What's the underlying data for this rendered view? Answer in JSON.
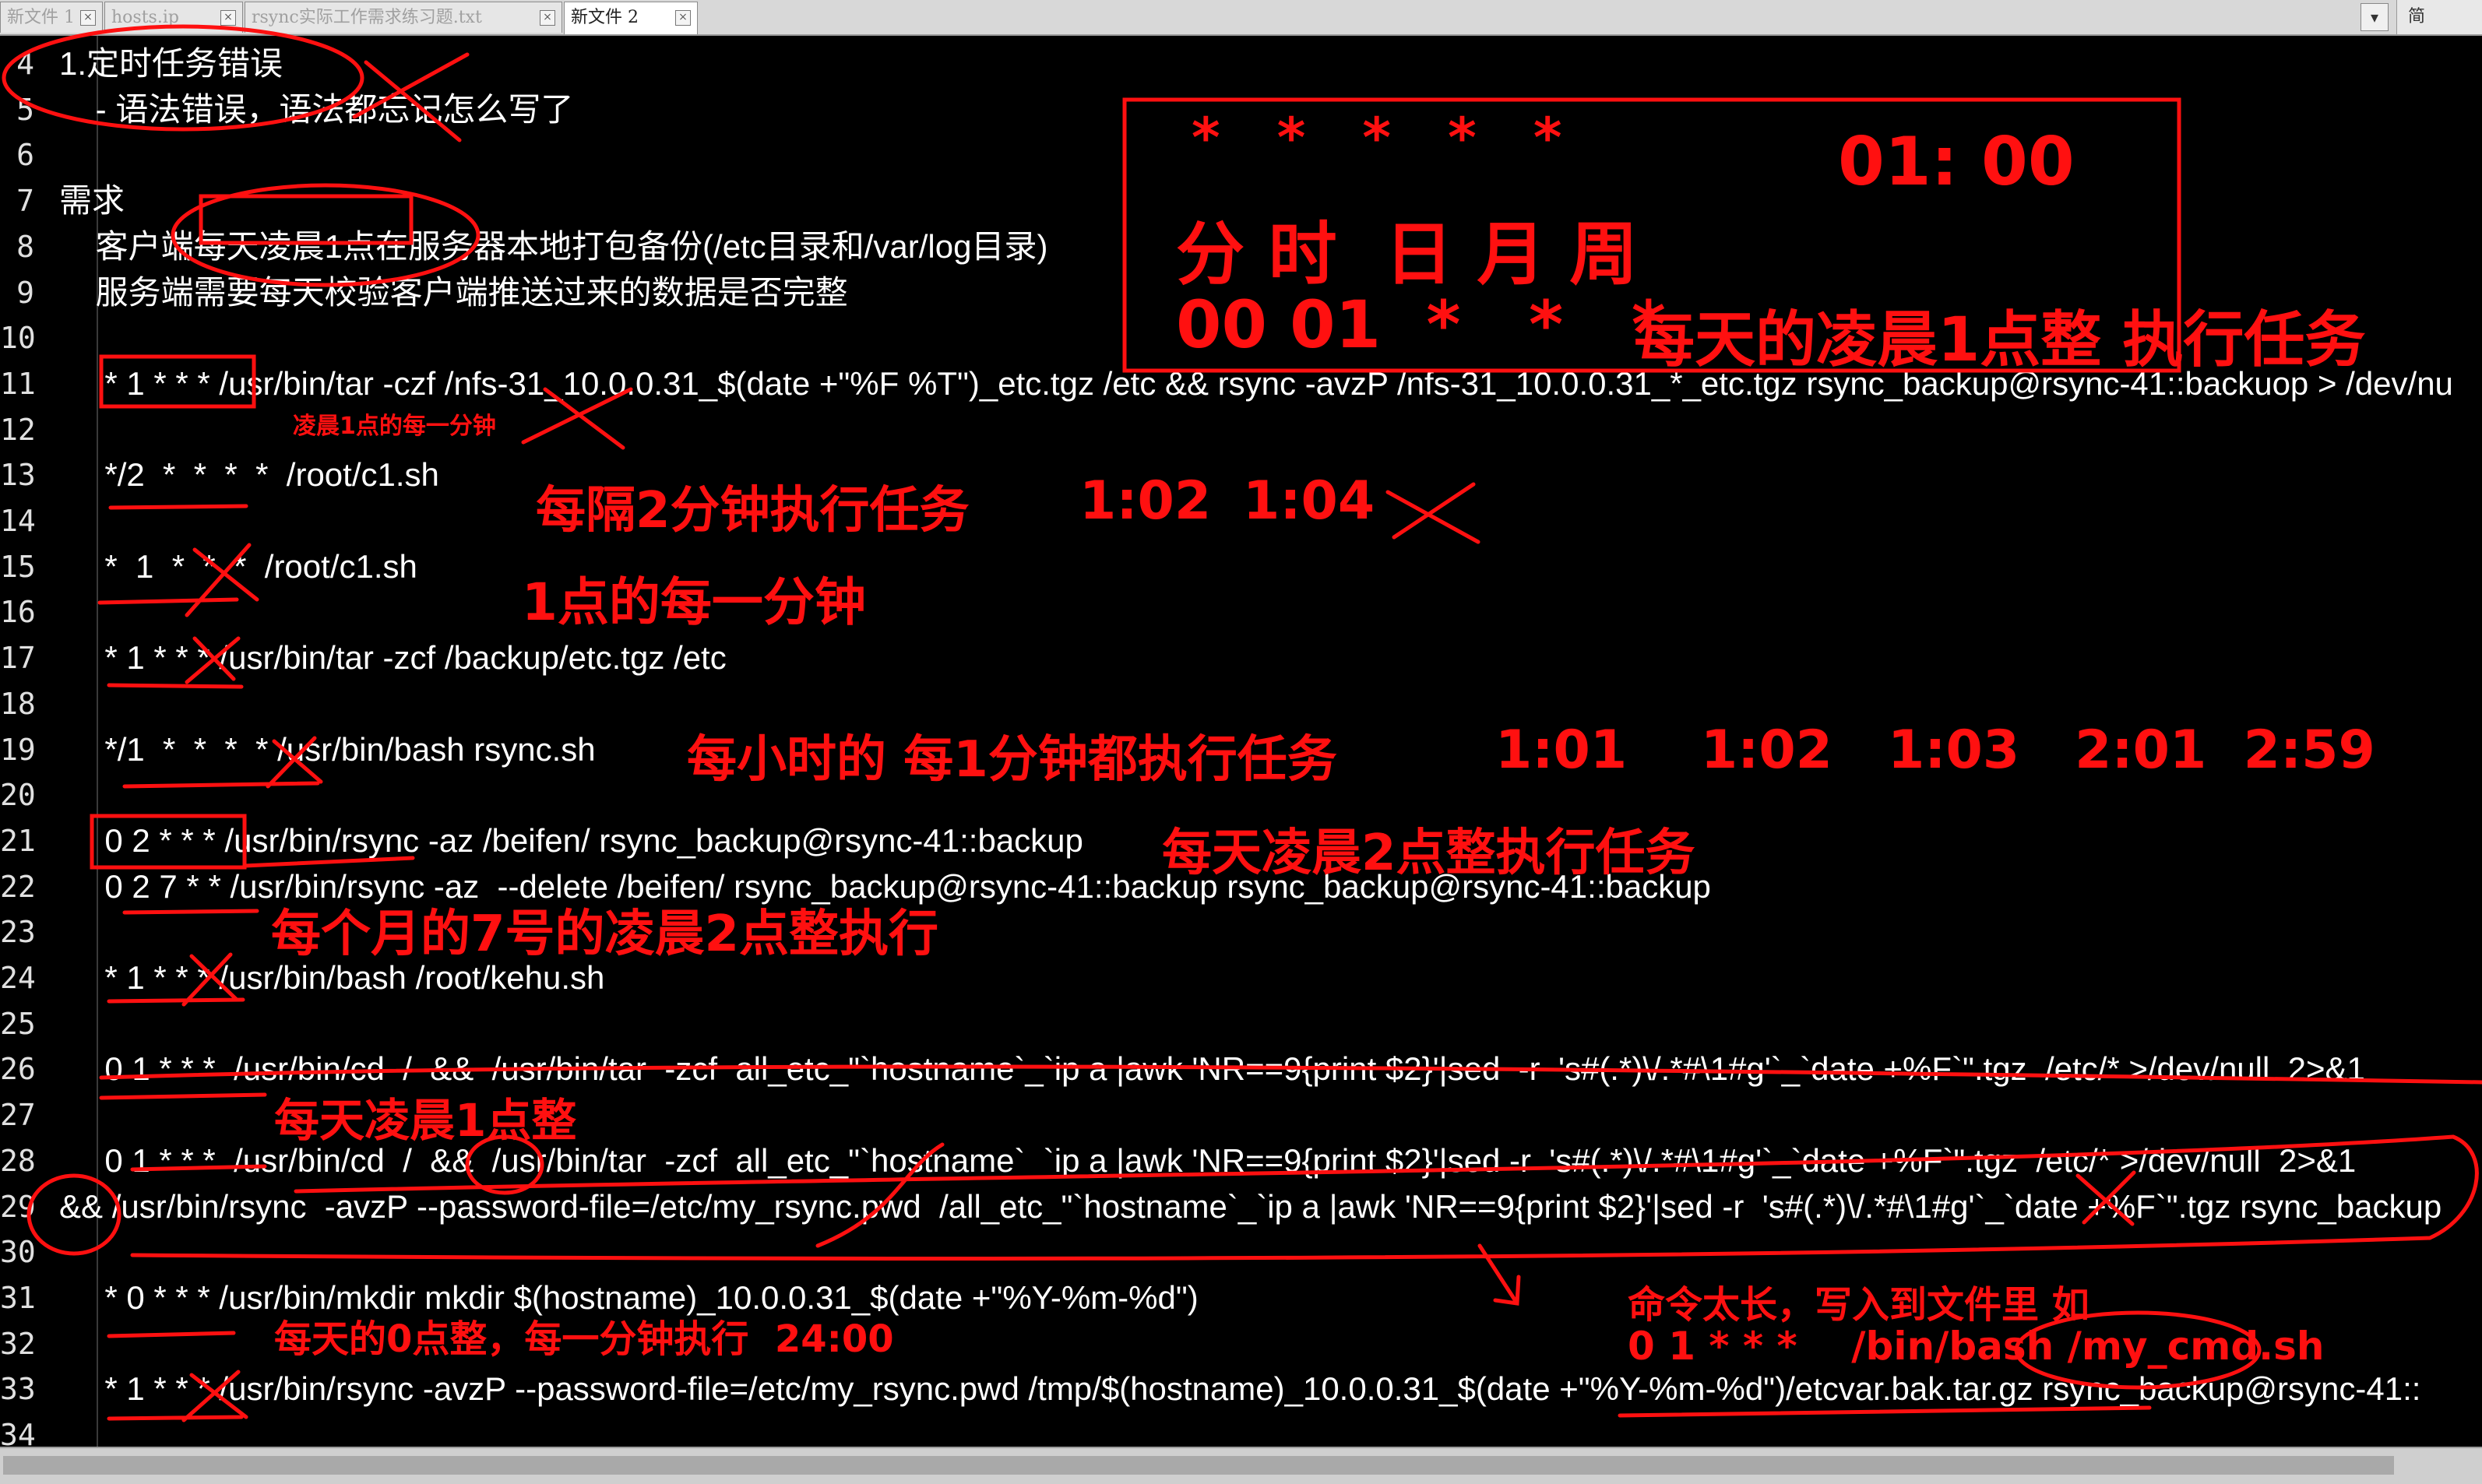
{
  "tabs": [
    {
      "label": "新文件 1"
    },
    {
      "label": "hosts.ip"
    },
    {
      "label": "rsync实际工作需求练习题.txt"
    },
    {
      "label": "新文件 2"
    }
  ],
  "tab_close_glyph": "×",
  "tab_dropdown_glyph": "▾",
  "side_panel_label": "简",
  "lines": [
    {
      "num": "4",
      "text": "1.定时任务错误"
    },
    {
      "num": "5",
      "text": "    - 语法错误，语法都忘记怎么写了"
    },
    {
      "num": "6",
      "text": ""
    },
    {
      "num": "7",
      "text": "需求"
    },
    {
      "num": "8",
      "text": "    客户端每天凌晨1点在服务器本地打包备份(/etc目录和/var/log目录)"
    },
    {
      "num": "9",
      "text": "    服务端需要每天校验客户端推送过来的数据是否完整"
    },
    {
      "num": "10",
      "text": ""
    },
    {
      "num": "11",
      "text": "     * 1 * * * /usr/bin/tar -czf /nfs-31_10.0.0.31_$(date +\"%F %T\")_etc.tgz /etc && rsync -avzP /nfs-31_10.0.0.31_*_etc.tgz rsync_backup@rsync-41::backuop > /dev/nu"
    },
    {
      "num": "12",
      "text": ""
    },
    {
      "num": "13",
      "text": "     */2  *  *  *  *  /root/c1.sh"
    },
    {
      "num": "14",
      "text": ""
    },
    {
      "num": "15",
      "text": "     *  1  *  *  *  /root/c1.sh"
    },
    {
      "num": "16",
      "text": ""
    },
    {
      "num": "17",
      "text": "     * 1 * * * /usr/bin/tar -zcf /backup/etc.tgz /etc"
    },
    {
      "num": "18",
      "text": ""
    },
    {
      "num": "19",
      "text": "     */1  *  *  *  * /usr/bin/bash rsync.sh"
    },
    {
      "num": "20",
      "text": ""
    },
    {
      "num": "21",
      "text": "     0 2 * * * /usr/bin/rsync -az /beifen/ rsync_backup@rsync-41::backup"
    },
    {
      "num": "22",
      "text": "     0 2 7 * * /usr/bin/rsync -az  --delete /beifen/ rsync_backup@rsync-41::backup rsync_backup@rsync-41::backup"
    },
    {
      "num": "23",
      "text": ""
    },
    {
      "num": "24",
      "text": "     * 1 * * * /usr/bin/bash /root/kehu.sh"
    },
    {
      "num": "25",
      "text": ""
    },
    {
      "num": "26",
      "text": "     0 1 * * *  /usr/bin/cd  /  &&  /usr/bin/tar  -zcf  all_etc_\"`hostname`_`ip a |awk 'NR==9{print $2}'|sed  -r  's#(.*)\\/.*#\\1#g'`_`date +%F`\".tgz  /etc/* >/dev/null  2>&1"
    },
    {
      "num": "27",
      "text": ""
    },
    {
      "num": "28",
      "text": "     0 1 * * *  /usr/bin/cd  /  &&  /usr/bin/tar  -zcf  all_etc_\"`hostname`_`ip a |awk 'NR==9{print $2}'|sed -r  's#(.*)\\/.*#\\1#g'`_`date +%F`\".tgz  /etc/* >/dev/null  2>&1"
    },
    {
      "num": "29",
      "text": "&& /usr/bin/rsync  -avzP --password-file=/etc/my_rsync.pwd  /all_etc_\"`hostname`_`ip a |awk 'NR==9{print $2}'|sed -r  's#(.*)\\/.*#\\1#g'`_`date +%F`\".tgz rsync_backup"
    },
    {
      "num": "30",
      "text": ""
    },
    {
      "num": "31",
      "text": "     * 0 * * * /usr/bin/mkdir mkdir $(hostname)_10.0.0.31_$(date +\"%Y-%m-%d\")"
    },
    {
      "num": "32",
      "text": ""
    },
    {
      "num": "33",
      "text": "     * 1 * * * /usr/bin/rsync -avzP --password-file=/etc/my_rsync.pwd /tmp/$(hostname)_10.0.0.31_$(date +\"%Y-%m-%d\")/etcvar.bak.tar.gz rsync_backup@rsync-41::"
    },
    {
      "num": "34",
      "text": ""
    }
  ],
  "annotations": {
    "box_stars": "*   *   *   *   *",
    "box_time": "01: 00",
    "box_fields": "分 时  日 月 周",
    "box_example": "00 01  *   *   *",
    "box_desc": "每天的凌晨1点整 执行任务",
    "l12_note": "凌晨1点的每一分钟",
    "l13_note": "每隔2分钟执行任务",
    "l13_t1": "1:02",
    "l13_t2": "1:04",
    "l15_note": "1点的每一分钟",
    "l19_note": "每小时的 每1分钟都执行任务",
    "l19_times": "1:01    1:02   1:03   2:01  2:59",
    "l21_note": "每天凌晨2点整执行任务",
    "l22_note": "每个月的7号的凌晨2点整执行",
    "l27_note": "每天凌晨1点整",
    "l31_note": "每天的0点整，每一分钟执行  24:00",
    "cmd_note_1": "命令太长，写入到文件里 如",
    "cmd_note_2": "0 1 * * *    /bin/bash /my_cmd.sh"
  },
  "colors": {
    "annotation": "#ff1010",
    "editor_bg": "#000000",
    "code_text": "#ffffff"
  }
}
